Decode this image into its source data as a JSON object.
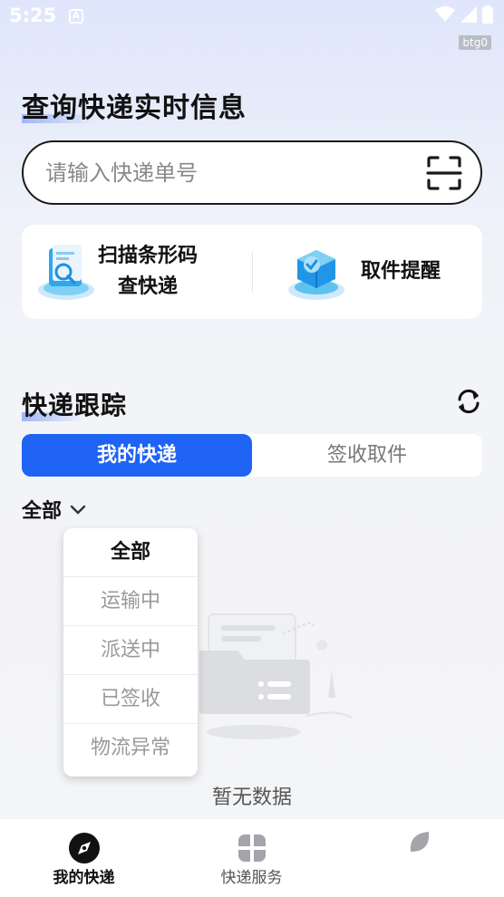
{
  "status_bar": {
    "time": "5:25",
    "notification_letter": "A",
    "debug_badge": "btg0"
  },
  "page": {
    "title": "查询快递实时信息"
  },
  "search": {
    "placeholder": "请输入快递单号"
  },
  "quick_actions": [
    {
      "label_line1": "扫描条形码",
      "label_line2": "查快递",
      "icon": "scan-package-icon"
    },
    {
      "label": "取件提醒",
      "icon": "pickup-box-icon"
    }
  ],
  "tracking": {
    "title": "快递跟踪",
    "tabs": [
      "我的快递",
      "签收取件"
    ],
    "active_tab": "我的快递",
    "filter": {
      "selected": "全部"
    },
    "filter_options": [
      "全部",
      "运输中",
      "派送中",
      "已签收",
      "物流异常"
    ],
    "empty_text": "暂无数据"
  },
  "bottom_nav": [
    {
      "label": "我的快递",
      "icon": "compass-icon",
      "active": true
    },
    {
      "label": "快递服务",
      "icon": "grid-petals-icon",
      "active": false
    },
    {
      "label": "",
      "icon": "leaf-icon",
      "active": false
    }
  ],
  "colors": {
    "accent": "#1f63f4",
    "text": "#111111",
    "muted": "#999999"
  }
}
